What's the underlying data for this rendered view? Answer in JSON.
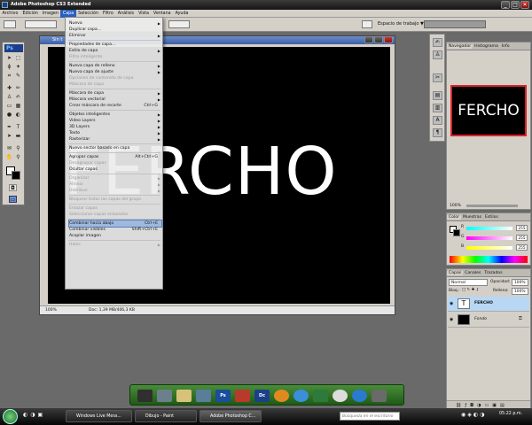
{
  "app": {
    "title": "Adobe Photoshop CS3 Extended",
    "min": "_",
    "max": "□",
    "close": "✕"
  },
  "menubar": [
    "Archivo",
    "Edición",
    "Imagen",
    "Capa",
    "Selección",
    "Filtro",
    "Análisis",
    "Vista",
    "Ventana",
    "Ayuda"
  ],
  "optionsbar": {
    "workspace": "Espacio de trabajo ▼"
  },
  "document": {
    "title": "Sin t",
    "canvas_text": "FERCHO",
    "zoom": "100%",
    "doc_info": "Doc: 1,39 MB/406,3 KB"
  },
  "layer_menu": [
    {
      "label": "Nueva",
      "arrow": true,
      "disabled": false
    },
    {
      "label": "Duplicar capa...",
      "disabled": false
    },
    {
      "label": "Eliminar",
      "arrow": true,
      "disabled": false
    },
    {
      "sep": true
    },
    {
      "label": "Propiedades de capa...",
      "disabled": false
    },
    {
      "label": "Estilo de capa",
      "arrow": true,
      "disabled": false
    },
    {
      "label": "Filtro inteligente",
      "disabled": true
    },
    {
      "sep": true
    },
    {
      "label": "Nueva capa de relleno",
      "arrow": true,
      "disabled": false
    },
    {
      "label": "Nueva capa de ajuste",
      "arrow": true,
      "disabled": false
    },
    {
      "label": "Opciones de contenido de capa",
      "disabled": true
    },
    {
      "label": "Máscara de capa",
      "disabled": true
    },
    {
      "sep": true
    },
    {
      "label": "Máscara de capa",
      "arrow": true,
      "disabled": false
    },
    {
      "label": "Máscara vectorial",
      "arrow": true,
      "disabled": false
    },
    {
      "label": "Crear máscara de recorte",
      "shortcut": "Ctrl+G",
      "disabled": false
    },
    {
      "sep": true
    },
    {
      "label": "Objetos inteligentes",
      "arrow": true,
      "disabled": false
    },
    {
      "label": "Video Layers",
      "arrow": true,
      "disabled": false
    },
    {
      "label": "3D Layers",
      "arrow": true,
      "disabled": false
    },
    {
      "label": "Texto",
      "arrow": true,
      "disabled": false
    },
    {
      "label": "Rasterizar",
      "arrow": true,
      "disabled": false
    },
    {
      "sep": true
    },
    {
      "label": "Nuevo sector basado en capa",
      "disabled": false
    },
    {
      "sep": true
    },
    {
      "label": "Agrupar capas",
      "shortcut": "Alt+Ctrl+G",
      "disabled": false
    },
    {
      "label": "Desagrupar capas",
      "disabled": true
    },
    {
      "label": "Ocultar capas",
      "disabled": false
    },
    {
      "sep": true
    },
    {
      "label": "Organizar",
      "arrow": true,
      "disabled": true
    },
    {
      "label": "Alinear",
      "arrow": true,
      "disabled": true
    },
    {
      "label": "Distribuir",
      "arrow": true,
      "disabled": true
    },
    {
      "sep": true
    },
    {
      "label": "Bloquear todas las capas del grupo",
      "disabled": true
    },
    {
      "sep": true
    },
    {
      "label": "Enlazar capas",
      "disabled": true
    },
    {
      "label": "Seleccionar capas enlazadas",
      "disabled": true
    },
    {
      "sep": true
    },
    {
      "label": "Combinar hacia abajo",
      "shortcut": "Ctrl+E",
      "disabled": false,
      "highlight": true
    },
    {
      "label": "Combinar visibles",
      "shortcut": "Shift+Ctrl+E",
      "disabled": false
    },
    {
      "label": "Acoplar imagen",
      "disabled": false
    },
    {
      "sep": true
    },
    {
      "label": "Halos",
      "arrow": true,
      "disabled": true
    }
  ],
  "navigator": {
    "tabs": [
      "Navegador",
      "Histograma",
      "Info"
    ],
    "thumb_text": "FERCHO",
    "zoom": "100%"
  },
  "color_panel": {
    "tabs": [
      "Color",
      "Muestras",
      "Estilos"
    ],
    "rows": [
      {
        "label": "R",
        "value": "255"
      },
      {
        "label": "G",
        "value": "255"
      },
      {
        "label": "B",
        "value": "255"
      }
    ]
  },
  "layers_panel": {
    "tabs": [
      "Capas",
      "Canales",
      "Trazados"
    ],
    "blend_mode": "Normal",
    "opacity_label": "Opacidad:",
    "opacity_value": "100%",
    "lock_label": "Bloq.:",
    "fill_label": "Relleno:",
    "fill_value": "100%",
    "layers": [
      {
        "name": "FERCHO",
        "thumb": "T",
        "selected": true
      },
      {
        "name": "Fondo",
        "thumb": "",
        "selected": false
      }
    ]
  },
  "taskbar": {
    "tasks": [
      "Windows Live Mess...",
      "Dibujo - Paint",
      "Adobe Photoshop C..."
    ],
    "search_placeholder": "Búsqueda en el escritorio",
    "clock": "05:22 p.m."
  },
  "quick_dock": {
    "icons": [
      "Ps",
      "Dc"
    ]
  }
}
